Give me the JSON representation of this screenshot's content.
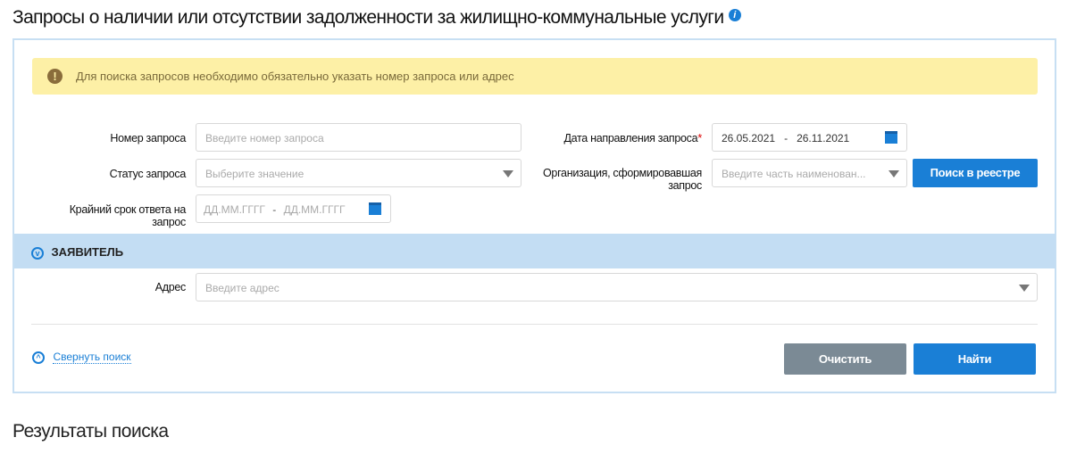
{
  "title": "Запросы о наличии или отсутствии задолженности за жилищно-коммунальные услуги",
  "alert": "Для поиска запросов необходимо обязательно указать номер запроса или адрес",
  "fields": {
    "number": {
      "label": "Номер запроса",
      "placeholder": "Введите номер запроса"
    },
    "status": {
      "label": "Статус запроса",
      "placeholder": "Выберите значение"
    },
    "deadline": {
      "label": "Крайний срок ответа на запрос",
      "from": "ДД.ММ.ГГГГ",
      "sep": "-",
      "to": "ДД.ММ.ГГГГ"
    },
    "sent_date": {
      "label": "Дата направления запроса",
      "required": "*",
      "from": "26.05.2021",
      "sep": "-",
      "to": "26.11.2021"
    },
    "org": {
      "label": "Организация, сформировавшая запрос",
      "placeholder": "Введите часть наименован..."
    },
    "address": {
      "label": "Адрес",
      "placeholder": "Введите адрес"
    }
  },
  "registry_button": "Поиск в реестре",
  "applicant_section": "ЗАЯВИТЕЛЬ",
  "collapse_link": "Свернуть поиск",
  "clear_button": "Очистить",
  "find_button": "Найти",
  "results_title": "Результаты поиска",
  "colors": {
    "accent": "#1a7fd6",
    "band": "#c3ddf3",
    "alert": "#fdf0a6",
    "clear": "#7b8a95"
  }
}
